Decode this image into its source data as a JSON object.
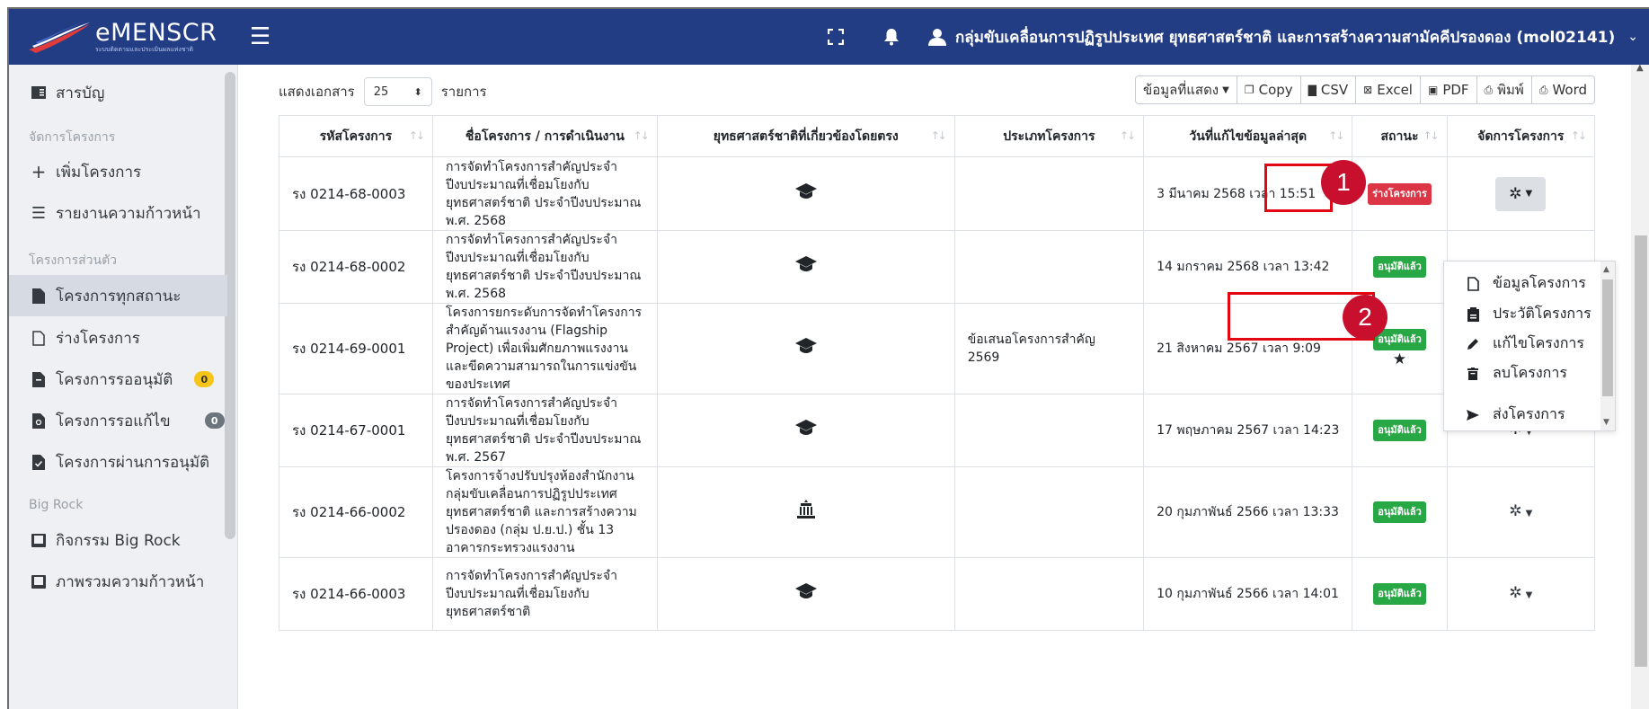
{
  "app": {
    "brand_name": "eMENSCR",
    "brand_sub": "ระบบติดตามและประเมินผลแห่งชาติ",
    "user_name": "กลุ่มขับเคลื่อนการปฏิรูปประเทศ ยุทธศาสตร์ชาติ และการสร้างความสามัคคีปรองดอง (mol02141)"
  },
  "sidebar": {
    "toc": "สารบัญ",
    "section_manage": "จัดการโครงการ",
    "add_project": "เพิ่มโครงการ",
    "progress_report": "รายงานความก้าวหน้า",
    "section_personal": "โครงการส่วนตัว",
    "all_status": "โครงการทุกสถานะ",
    "draft": "ร่างโครงการ",
    "pending_approval": "โครงการรออนุมัติ",
    "pending_approval_count": "0",
    "pending_edit": "โครงการรอแก้ไข",
    "pending_edit_count": "0",
    "approved": "โครงการผ่านการอนุมัติ",
    "section_bigrock": "Big Rock",
    "bigrock_activity": "กิจกรรม Big Rock",
    "bigrock_overview": "ภาพรวมความก้าวหน้า"
  },
  "toolbar": {
    "show_label": "แสดงเอกสาร",
    "page_length": "25",
    "items_label": "รายการ",
    "columns_button": "ข้อมูลที่แสดง",
    "copy": "Copy",
    "csv": "CSV",
    "excel": "Excel",
    "pdf": "PDF",
    "print": "พิมพ์",
    "word": "Word"
  },
  "table": {
    "headers": [
      "รหัสโครงการ",
      "ชื่อโครงการ / การดำเนินงาน",
      "ยุทธศาสตร์ชาติที่เกี่ยวข้องโดยตรง",
      "ประเภทโครงการ",
      "วันที่แก้ไขข้อมูลล่าสุด",
      "สถานะ",
      "จัดการโครงการ"
    ],
    "rows": [
      {
        "code": "รง 0214-68-0003",
        "name": "การจัดทำโครงการสำคัญประจำปีงบประมาณที่เชื่อมโยงกับยุทธศาสตร์ชาติ ประจำปีงบประมาณ พ.ศ. 2568",
        "type": "",
        "date": "3 มีนาคม 2568 เวลา 15:51",
        "status": "ร่างโครงการ"
      },
      {
        "code": "รง 0214-68-0002",
        "name": "การจัดทำโครงการสำคัญประจำปีงบประมาณที่เชื่อมโยงกับยุทธศาสตร์ชาติ ประจำปีงบประมาณ พ.ศ. 2568",
        "type": "",
        "date": "14 มกราคม 2568 เวลา 13:42",
        "status": "อนุมัติแล้ว"
      },
      {
        "code": "รง 0214-69-0001",
        "name": "โครงการยกระดับการจัดทำโครงการสำคัญด้านแรงงาน (Flagship Project) เพื่อเพิ่มศักยภาพแรงงานและขีดความสามารถในการแข่งขันของประเทศ",
        "type": "ข้อเสนอโครงการสำคัญ 2569",
        "date": "21 สิงหาคม 2567 เวลา 9:09",
        "status": "อนุมัติแล้ว"
      },
      {
        "code": "รง 0214-67-0001",
        "name": "การจัดทำโครงการสำคัญประจำปีงบประมาณที่เชื่อมโยงกับยุทธศาสตร์ชาติ ประจำปีงบประมาณ พ.ศ. 2567",
        "type": "",
        "date": "17 พฤษภาคม 2567 เวลา 14:23",
        "status": "อนุมัติแล้ว"
      },
      {
        "code": "รง 0214-66-0002",
        "name": "โครงการจ้างปรับปรุงห้องสำนักงานกลุ่มขับเคลื่อนการปฏิรูปประเทศ ยุทธศาสตร์ชาติ และการสร้างความปรองดอง (กลุ่ม ป.ย.ป.) ชั้น 13 อาคารกระทรวงแรงงาน",
        "type": "",
        "date": "20 กุมภาพันธ์ 2566 เวลา 13:33",
        "status": "อนุมัติแล้ว"
      },
      {
        "code": "รง 0214-66-0003",
        "name": "การจัดทำโครงการสำคัญประจำปีงบประมาณที่เชื่อมโยงกับยุทธศาสตร์ชาติ",
        "type": "",
        "date": "10 กุมภาพันธ์ 2566 เวลา 14:01",
        "status": "อนุมัติแล้ว"
      }
    ]
  },
  "dropdown": {
    "info": "ข้อมูลโครงการ",
    "history": "ประวัติโครงการ",
    "edit": "แก้ไขโครงการ",
    "delete": "ลบโครงการ",
    "send": "ส่งโครงการ"
  },
  "callouts": {
    "one": "1",
    "two": "2"
  },
  "colors": {
    "navbar": "#233d85",
    "highlight": "#e30613",
    "callout": "#c8102e",
    "approved": "#28a745",
    "draft": "#dc3545"
  }
}
